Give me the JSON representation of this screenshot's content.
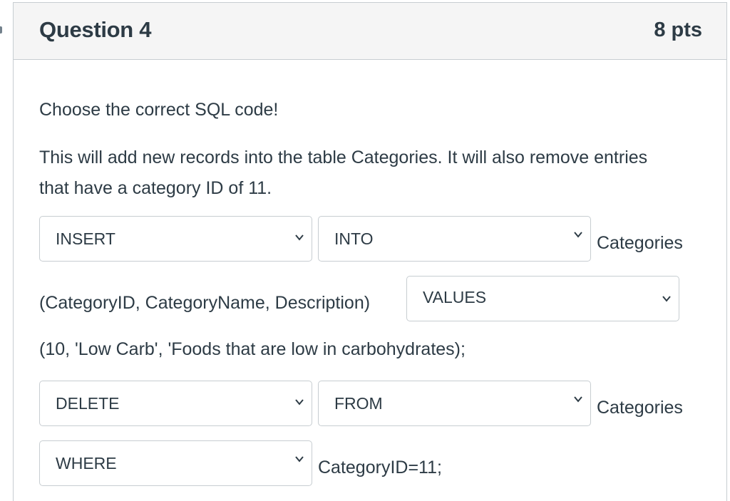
{
  "question": {
    "title": "Question 4",
    "points": "8 pts",
    "prompt": "Choose the correct SQL code!",
    "description": "This will add new records into the table Categories. It will also remove entries that have a category ID of 11."
  },
  "line1": {
    "select1": "INSERT",
    "select2": "INTO",
    "suffix": "Categories"
  },
  "line2": {
    "prefix": "(CategoryID, CategoryName, Description)",
    "select": "VALUES"
  },
  "line3": {
    "text": "(10, 'Low Carb', 'Foods that are low in carbohydrates);"
  },
  "line4": {
    "select1": "DELETE",
    "select2": "FROM",
    "suffix": "Categories"
  },
  "line5": {
    "select": "WHERE",
    "suffix": "CategoryID=11;"
  },
  "icons": {
    "dropdown": "chevron-down-icon"
  }
}
